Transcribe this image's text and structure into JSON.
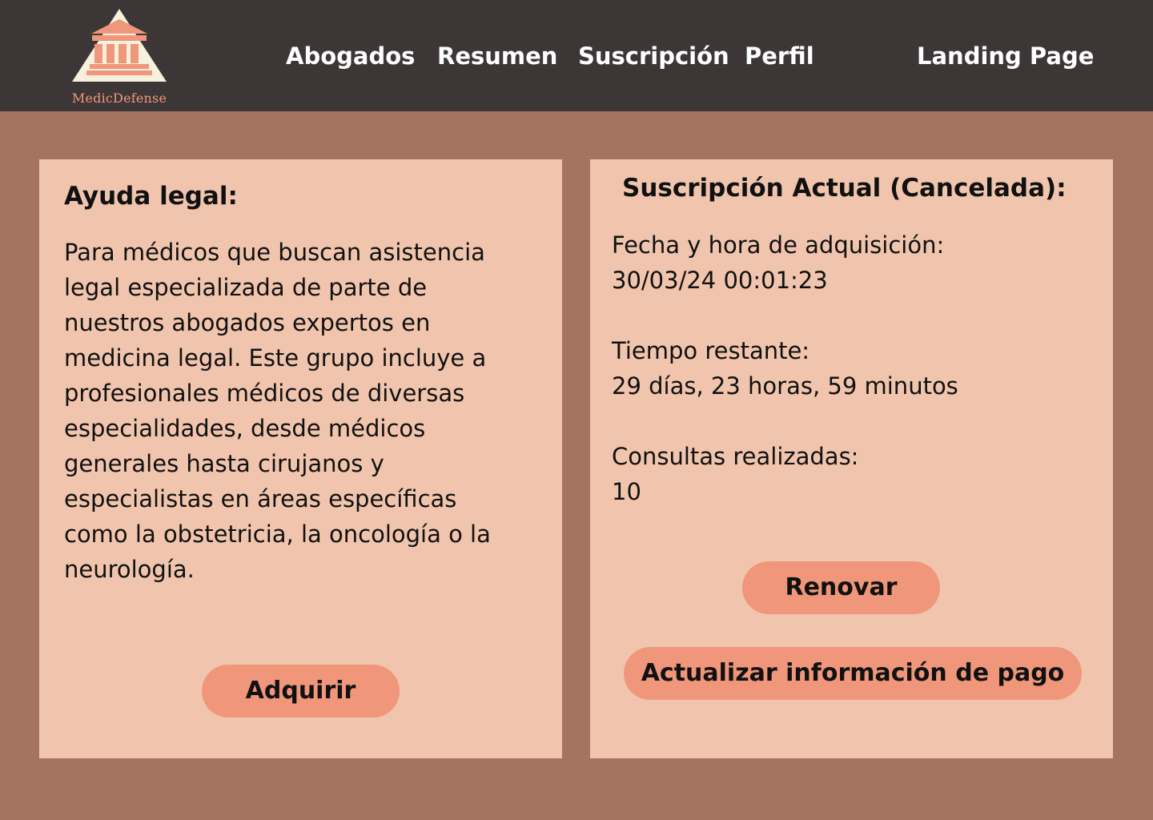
{
  "brand": {
    "name": "MedicDefense"
  },
  "nav": {
    "abogados": "Abogados",
    "resumen": "Resumen",
    "suscripcion": "Suscripción",
    "perfil": "Perfil",
    "landing": "Landing Page",
    "active": "Suscripción"
  },
  "legal_card": {
    "title": "Ayuda legal:",
    "description_lines": [
      "Para médicos que buscan asistencia",
      "legal especializada de parte de",
      "nuestros abogados expertos en",
      "medicina legal. Este grupo incluye a",
      "profesionales médicos de diversas",
      "especialidades, desde médicos",
      "generales hasta cirujanos y",
      "especialistas en áreas específicas",
      "como la obstetricia, la oncología o la",
      "neurología."
    ],
    "button_label": "Adquirir"
  },
  "subscription_card": {
    "title": "Suscripción Actual (Cancelada):",
    "purchase_label": "Fecha y hora de adquisición:",
    "purchase_value": "30/03/24 00:01:23",
    "remaining_label": "Tiempo restante:",
    "remaining_value": "29 días, 23 horas, 59 minutos",
    "consults_label": "Consultas realizadas:",
    "consults_value": "10",
    "renew_button": "Renovar",
    "update_payment_button": "Actualizar información de pago"
  },
  "colors": {
    "background": "#a57461",
    "topbar": "#3c3637",
    "card": "#f1c5ad",
    "button": "#f0967a",
    "logo_triangle": "#f6f0dc",
    "logo_building": "#f0967a"
  },
  "icons": {
    "logo": "courthouse-icon"
  }
}
